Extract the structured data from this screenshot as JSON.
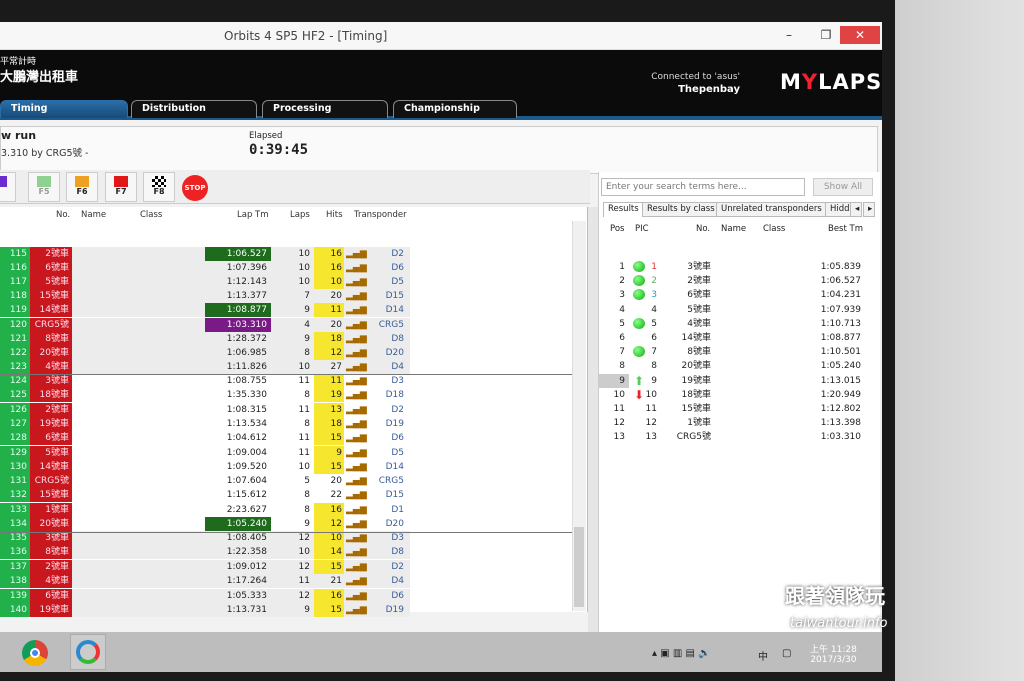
{
  "window": {
    "title": "Orbits 4 SP5 HF2 - [Timing]",
    "minimize": "–",
    "restore": "❐",
    "close": "✕"
  },
  "header": {
    "brand_line1": "平常計時",
    "brand_line2": "大鵬灣出租車",
    "connected": "Connected to 'asus'",
    "site": "Thepenbay",
    "logo_pre": "M",
    "logo_y": "Y",
    "logo_post": "LAPS"
  },
  "tabs": [
    {
      "label": "Timing",
      "active": true
    },
    {
      "label": "Distribution"
    },
    {
      "label": "Processing"
    },
    {
      "label": "Championship"
    }
  ],
  "info": {
    "run": "w run",
    "best": "3.310 by CRG5號 -",
    "elapsed_label": "Elapsed",
    "elapsed": "0:39:45"
  },
  "flags": [
    {
      "key": "F5",
      "color": "#8fd18f"
    },
    {
      "key": "F6",
      "color": "#f0a020"
    },
    {
      "key": "F7",
      "color": "#e01818"
    },
    {
      "key": "F8",
      "color": "checkered"
    }
  ],
  "stop_label": "STOP",
  "passings": {
    "columns": [
      "No.",
      "Name",
      "Class",
      "Lap Tm",
      "Laps",
      "Hits",
      "Transponder"
    ],
    "rows": [
      [
        "115",
        "2號車",
        "1:06.527",
        "10",
        "16",
        "D2",
        "green",
        true
      ],
      [
        "116",
        "6號車",
        "1:07.396",
        "10",
        "16",
        "D6",
        "",
        true
      ],
      [
        "117",
        "5號車",
        "1:12.143",
        "10",
        "10",
        "D5",
        "",
        true
      ],
      [
        "118",
        "15號車",
        "1:13.377",
        "7",
        "20",
        "D15",
        "",
        false
      ],
      [
        "119",
        "14號車",
        "1:08.877",
        "9",
        "11",
        "D14",
        "green",
        true
      ],
      [
        "120",
        "CRG5號",
        "1:03.310",
        "4",
        "20",
        "CRG5",
        "purple",
        false
      ],
      [
        "121",
        "8號車",
        "1:28.372",
        "9",
        "18",
        "D8",
        "",
        true
      ],
      [
        "122",
        "20號車",
        "1:06.985",
        "8",
        "12",
        "D20",
        "",
        true
      ],
      [
        "123",
        "4號車",
        "1:11.826",
        "10",
        "27",
        "D4",
        "",
        false
      ],
      [
        "124",
        "3號車",
        "1:08.755",
        "11",
        "11",
        "D3",
        "",
        true
      ],
      [
        "125",
        "18號車",
        "1:35.330",
        "8",
        "19",
        "D18",
        "",
        true
      ],
      [
        "126",
        "2號車",
        "1:08.315",
        "11",
        "13",
        "D2",
        "",
        true
      ],
      [
        "127",
        "19號車",
        "1:13.534",
        "8",
        "18",
        "D19",
        "",
        true
      ],
      [
        "128",
        "6號車",
        "1:04.612",
        "11",
        "15",
        "D6",
        "",
        true
      ],
      [
        "129",
        "5號車",
        "1:09.004",
        "11",
        "9",
        "D5",
        "",
        true
      ],
      [
        "130",
        "14號車",
        "1:09.520",
        "10",
        "15",
        "D14",
        "",
        true
      ],
      [
        "131",
        "CRG5號",
        "1:07.604",
        "5",
        "20",
        "CRG5",
        "",
        false
      ],
      [
        "132",
        "15號車",
        "1:15.612",
        "8",
        "22",
        "D15",
        "",
        false
      ],
      [
        "133",
        "1號車",
        "2:23.627",
        "8",
        "16",
        "D1",
        "",
        true
      ],
      [
        "134",
        "20號車",
        "1:05.240",
        "9",
        "12",
        "D20",
        "green",
        true
      ],
      [
        "135",
        "3號車",
        "1:08.405",
        "12",
        "10",
        "D3",
        "",
        true
      ],
      [
        "136",
        "8號車",
        "1:22.358",
        "10",
        "14",
        "D8",
        "",
        true
      ],
      [
        "137",
        "2號車",
        "1:09.012",
        "12",
        "15",
        "D2",
        "",
        true
      ],
      [
        "138",
        "4號車",
        "1:17.264",
        "11",
        "21",
        "D4",
        "",
        false
      ],
      [
        "139",
        "6號車",
        "1:05.333",
        "12",
        "16",
        "D6",
        "",
        true
      ],
      [
        "140",
        "19號車",
        "1:13.731",
        "9",
        "15",
        "D19",
        "",
        true
      ]
    ]
  },
  "colors": {
    "lap_green": "#1e6b1e",
    "lap_purple": "#7a1a86",
    "hits_yellow": "#f7e62e",
    "id_green": "#22b04a",
    "no_red": "#c8171d"
  },
  "results": {
    "search_placeholder": "Enter your search terms here...",
    "show_all": "Show All",
    "tabs": [
      "Results",
      "Results by class",
      "Unrelated transponders",
      "Hidd"
    ],
    "columns": [
      "Pos",
      "PIC",
      "No.",
      "Name",
      "Class",
      "Best Tm"
    ],
    "rows": [
      [
        "1",
        "green-dot",
        "1",
        "3號車",
        "1:05.839"
      ],
      [
        "2",
        "green-dot",
        "2",
        "2號車",
        "1:06.527"
      ],
      [
        "3",
        "green-dot",
        "3",
        "6號車",
        "1:04.231"
      ],
      [
        "4",
        "",
        "4",
        "5號車",
        "1:07.939"
      ],
      [
        "5",
        "green-dot",
        "5",
        "4號車",
        "1:10.713"
      ],
      [
        "6",
        "",
        "6",
        "14號車",
        "1:08.877"
      ],
      [
        "7",
        "green-dot",
        "7",
        "8號車",
        "1:10.501"
      ],
      [
        "8",
        "",
        "8",
        "20號車",
        "1:05.240"
      ],
      [
        "9",
        "up-arrow",
        "9",
        "19號車",
        "1:13.015"
      ],
      [
        "10",
        "down-arrow",
        "10",
        "18號車",
        "1:20.949"
      ],
      [
        "11",
        "",
        "11",
        "15號車",
        "1:12.802"
      ],
      [
        "12",
        "",
        "12",
        "1號車",
        "1:13.398"
      ],
      [
        "13",
        "",
        "13",
        "CRG5號",
        "1:03.310"
      ]
    ]
  },
  "taskbar": {
    "time": "上午 11:28",
    "date": "2017/3/30",
    "ime": "中"
  },
  "watermark": {
    "line1": "跟著領隊玩",
    "line2": "taiwantour.info",
    "sig": "sky"
  }
}
